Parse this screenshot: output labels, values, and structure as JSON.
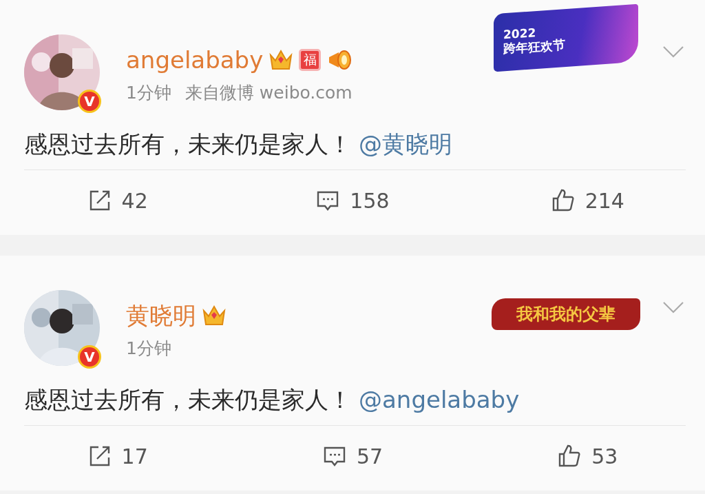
{
  "posts": [
    {
      "author": "angelababy",
      "badges": [
        {
          "kind": "crown"
        },
        {
          "kind": "fu",
          "text": "福"
        },
        {
          "kind": "megaphone"
        }
      ],
      "verified": "V",
      "time": "1分钟",
      "source": "来自微博 weibo.com",
      "skin": {
        "kind": "festival",
        "year": "2022",
        "title": "跨年狂欢节"
      },
      "content": [
        {
          "kind": "text",
          "text": "感恩过去所有，未来仍是家人！"
        },
        {
          "kind": "mention",
          "text": "@黄晓明"
        }
      ],
      "actions": [
        {
          "kind": "repost",
          "count": "42"
        },
        {
          "kind": "comment",
          "count": "158"
        },
        {
          "kind": "like",
          "count": "214"
        }
      ]
    },
    {
      "author": "黄晓明",
      "badges": [
        {
          "kind": "crown"
        }
      ],
      "verified": "V",
      "time": "1分钟",
      "skin": {
        "kind": "banner",
        "title": "我和我的父辈"
      },
      "content": [
        {
          "kind": "text",
          "text": "感恩过去所有，未来仍是家人！"
        },
        {
          "kind": "mention",
          "text": "@angelababy"
        }
      ],
      "actions": [
        {
          "kind": "repost",
          "count": "17"
        },
        {
          "kind": "comment",
          "count": "57"
        },
        {
          "kind": "like",
          "count": "53"
        }
      ]
    }
  ]
}
